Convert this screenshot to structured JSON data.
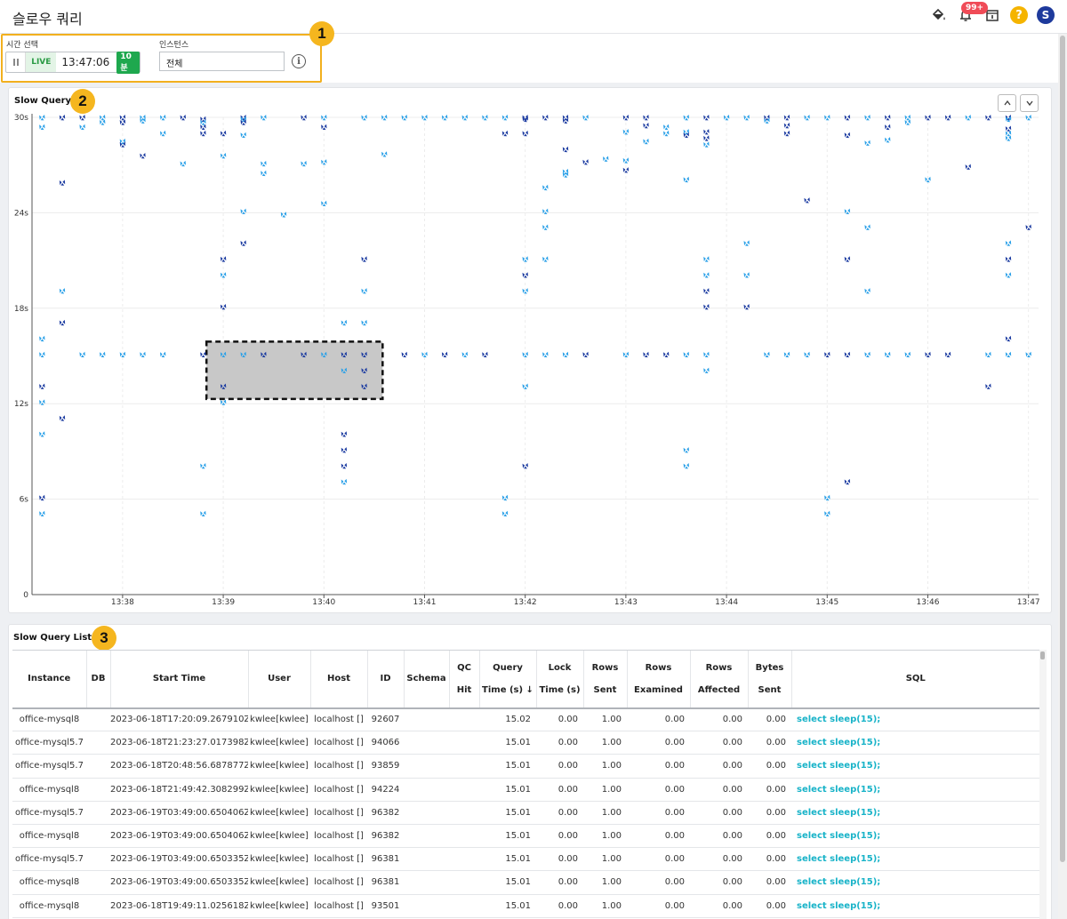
{
  "header": {
    "title": "슬로우 쿼리",
    "notification_count": "99+",
    "help_label": "?",
    "user_initial": "S"
  },
  "filters": {
    "time_label": "시간 선택",
    "live_label": "LIVE",
    "clock": "13:47:06",
    "range": "10분",
    "instance_label": "인스턴스",
    "instance_value": "전체"
  },
  "callouts": [
    "1",
    "2",
    "3"
  ],
  "chart": {
    "title": "Slow Query",
    "y_ticks": [
      "0",
      "6s",
      "12s",
      "18s",
      "24s",
      "30s"
    ],
    "x_ticks": [
      "13:38",
      "13:39",
      "13:40",
      "13:41",
      "13:42",
      "13:43",
      "13:44",
      "13:45",
      "13:46",
      "13:47"
    ]
  },
  "chart_data": {
    "type": "scatter",
    "title": "Slow Query",
    "y_unit": "s",
    "ylim": [
      0,
      30
    ],
    "x_range": [
      "13:37:06",
      "13:47:06"
    ],
    "colors": {
      "dark": "#1a3aa0",
      "light": "#2aa0e8"
    },
    "selection": {
      "x": [
        "13:38:50",
        "13:40:35"
      ],
      "y": [
        12.3,
        15.9
      ]
    },
    "points": [
      [
        "13:37:12",
        30,
        "l"
      ],
      [
        "13:37:12",
        29.4,
        "l"
      ],
      [
        "13:37:12",
        16.1,
        "l"
      ],
      [
        "13:37:12",
        15.1,
        "l"
      ],
      [
        "13:37:12",
        13.1,
        "d"
      ],
      [
        "13:37:12",
        12.1,
        "l"
      ],
      [
        "13:37:12",
        10.1,
        "l"
      ],
      [
        "13:37:12",
        6.1,
        "d"
      ],
      [
        "13:37:12",
        5.1,
        "l"
      ],
      [
        "13:37:24",
        30,
        "d"
      ],
      [
        "13:37:24",
        25.9,
        "d"
      ],
      [
        "13:37:24",
        19.1,
        "l"
      ],
      [
        "13:37:24",
        17.1,
        "d"
      ],
      [
        "13:37:24",
        11.1,
        "d"
      ],
      [
        "13:37:36",
        30,
        "d"
      ],
      [
        "13:37:36",
        29.4,
        "l"
      ],
      [
        "13:37:36",
        15.1,
        "l"
      ],
      [
        "13:37:48",
        30,
        "l"
      ],
      [
        "13:37:48",
        29.7,
        "l"
      ],
      [
        "13:37:48",
        15.1,
        "l"
      ],
      [
        "13:38:00",
        30,
        "d"
      ],
      [
        "13:38:00",
        29.7,
        "d"
      ],
      [
        "13:38:00",
        28.5,
        "l"
      ],
      [
        "13:38:00",
        28.3,
        "d"
      ],
      [
        "13:38:00",
        15.1,
        "l"
      ],
      [
        "13:38:12",
        30,
        "l"
      ],
      [
        "13:38:12",
        29.8,
        "l"
      ],
      [
        "13:38:12",
        27.6,
        "d"
      ],
      [
        "13:38:12",
        15.1,
        "l"
      ],
      [
        "13:38:24",
        30,
        "l"
      ],
      [
        "13:38:24",
        29,
        "l"
      ],
      [
        "13:38:24",
        15.1,
        "l"
      ],
      [
        "13:38:36",
        30,
        "d"
      ],
      [
        "13:38:36",
        27.1,
        "l"
      ],
      [
        "13:38:48",
        29.9,
        "d"
      ],
      [
        "13:38:48",
        29.7,
        "l"
      ],
      [
        "13:38:48",
        29.4,
        "d"
      ],
      [
        "13:38:48",
        29,
        "d"
      ],
      [
        "13:38:48",
        15.1,
        "d"
      ],
      [
        "13:38:48",
        8.1,
        "l"
      ],
      [
        "13:38:48",
        5.1,
        "l"
      ],
      [
        "13:39:00",
        29,
        "d"
      ],
      [
        "13:39:00",
        27.6,
        "l"
      ],
      [
        "13:39:00",
        21.1,
        "d"
      ],
      [
        "13:39:00",
        20.1,
        "l"
      ],
      [
        "13:39:00",
        18.1,
        "d"
      ],
      [
        "13:39:00",
        15.1,
        "l"
      ],
      [
        "13:39:00",
        13.1,
        "d"
      ],
      [
        "13:39:00",
        12.1,
        "l"
      ],
      [
        "13:39:12",
        30,
        "d"
      ],
      [
        "13:39:12",
        29.9,
        "l"
      ],
      [
        "13:39:12",
        29.7,
        "d"
      ],
      [
        "13:39:12",
        28.9,
        "l"
      ],
      [
        "13:39:12",
        24.1,
        "l"
      ],
      [
        "13:39:12",
        22.1,
        "d"
      ],
      [
        "13:39:12",
        15.1,
        "l"
      ],
      [
        "13:39:24",
        30,
        "l"
      ],
      [
        "13:39:24",
        27.1,
        "l"
      ],
      [
        "13:39:24",
        26.5,
        "l"
      ],
      [
        "13:39:24",
        15.1,
        "d"
      ],
      [
        "13:39:36",
        23.9,
        "l"
      ],
      [
        "13:39:48",
        30,
        "d"
      ],
      [
        "13:39:48",
        27.1,
        "l"
      ],
      [
        "13:39:48",
        15.1,
        "d"
      ],
      [
        "13:40:00",
        30,
        "l"
      ],
      [
        "13:40:00",
        29.4,
        "d"
      ],
      [
        "13:40:00",
        27.2,
        "l"
      ],
      [
        "13:40:00",
        24.6,
        "l"
      ],
      [
        "13:40:00",
        15.1,
        "l"
      ],
      [
        "13:40:12",
        17.1,
        "l"
      ],
      [
        "13:40:12",
        15.1,
        "d"
      ],
      [
        "13:40:12",
        14.1,
        "l"
      ],
      [
        "13:40:12",
        10.1,
        "d"
      ],
      [
        "13:40:12",
        9.1,
        "d"
      ],
      [
        "13:40:12",
        8.1,
        "d"
      ],
      [
        "13:40:12",
        7.1,
        "l"
      ],
      [
        "13:40:24",
        30,
        "l"
      ],
      [
        "13:40:24",
        21.1,
        "d"
      ],
      [
        "13:40:24",
        19.1,
        "l"
      ],
      [
        "13:40:24",
        17.1,
        "l"
      ],
      [
        "13:40:24",
        15.1,
        "d"
      ],
      [
        "13:40:24",
        14.1,
        "d"
      ],
      [
        "13:40:24",
        13.1,
        "d"
      ],
      [
        "13:40:36",
        30,
        "l"
      ],
      [
        "13:40:36",
        27.7,
        "l"
      ],
      [
        "13:40:48",
        30,
        "l"
      ],
      [
        "13:40:48",
        15.1,
        "d"
      ],
      [
        "13:41:00",
        30,
        "l"
      ],
      [
        "13:41:00",
        15.1,
        "l"
      ],
      [
        "13:41:12",
        30,
        "l"
      ],
      [
        "13:41:12",
        15.1,
        "d"
      ],
      [
        "13:41:24",
        30,
        "l"
      ],
      [
        "13:41:24",
        15.1,
        "l"
      ],
      [
        "13:41:36",
        30,
        "l"
      ],
      [
        "13:41:36",
        15.1,
        "d"
      ],
      [
        "13:41:48",
        30,
        "l"
      ],
      [
        "13:41:48",
        29,
        "d"
      ],
      [
        "13:41:48",
        6.1,
        "l"
      ],
      [
        "13:41:48",
        5.1,
        "l"
      ],
      [
        "13:42:00",
        30,
        "d"
      ],
      [
        "13:42:00",
        29.9,
        "d"
      ],
      [
        "13:42:00",
        29,
        "d"
      ],
      [
        "13:42:00",
        21.1,
        "l"
      ],
      [
        "13:42:00",
        20.1,
        "d"
      ],
      [
        "13:42:00",
        19.1,
        "l"
      ],
      [
        "13:42:00",
        15.1,
        "l"
      ],
      [
        "13:42:00",
        13.1,
        "l"
      ],
      [
        "13:42:00",
        8.1,
        "d"
      ],
      [
        "13:42:12",
        30,
        "d"
      ],
      [
        "13:42:12",
        25.6,
        "l"
      ],
      [
        "13:42:12",
        24.1,
        "l"
      ],
      [
        "13:42:12",
        23.1,
        "l"
      ],
      [
        "13:42:12",
        21.1,
        "l"
      ],
      [
        "13:42:12",
        15.1,
        "l"
      ],
      [
        "13:42:24",
        30,
        "d"
      ],
      [
        "13:42:24",
        29.8,
        "d"
      ],
      [
        "13:42:24",
        28,
        "d"
      ],
      [
        "13:42:24",
        26.6,
        "l"
      ],
      [
        "13:42:24",
        26.4,
        "l"
      ],
      [
        "13:42:24",
        15.1,
        "l"
      ],
      [
        "13:42:36",
        30,
        "l"
      ],
      [
        "13:42:36",
        27.2,
        "d"
      ],
      [
        "13:42:36",
        15.1,
        "d"
      ],
      [
        "13:42:48",
        27.4,
        "l"
      ],
      [
        "13:43:00",
        30,
        "d"
      ],
      [
        "13:43:00",
        29.1,
        "l"
      ],
      [
        "13:43:00",
        27.3,
        "l"
      ],
      [
        "13:43:00",
        26.7,
        "d"
      ],
      [
        "13:43:00",
        15.1,
        "l"
      ],
      [
        "13:43:12",
        30,
        "d"
      ],
      [
        "13:43:12",
        29.5,
        "d"
      ],
      [
        "13:43:12",
        28.5,
        "l"
      ],
      [
        "13:43:12",
        15.1,
        "d"
      ],
      [
        "13:43:24",
        29.4,
        "l"
      ],
      [
        "13:43:24",
        29,
        "l"
      ],
      [
        "13:43:24",
        15.1,
        "d"
      ],
      [
        "13:43:36",
        30,
        "l"
      ],
      [
        "13:43:36",
        29.1,
        "l"
      ],
      [
        "13:43:36",
        28.9,
        "d"
      ],
      [
        "13:43:36",
        26.1,
        "l"
      ],
      [
        "13:43:36",
        15.1,
        "l"
      ],
      [
        "13:43:36",
        9.1,
        "l"
      ],
      [
        "13:43:36",
        8.1,
        "l"
      ],
      [
        "13:43:48",
        30,
        "d"
      ],
      [
        "13:43:48",
        29.1,
        "d"
      ],
      [
        "13:43:48",
        28.7,
        "d"
      ],
      [
        "13:43:48",
        28.3,
        "l"
      ],
      [
        "13:43:48",
        21.1,
        "l"
      ],
      [
        "13:43:48",
        20.1,
        "l"
      ],
      [
        "13:43:48",
        19.1,
        "d"
      ],
      [
        "13:43:48",
        18.1,
        "d"
      ],
      [
        "13:43:48",
        15.1,
        "l"
      ],
      [
        "13:43:48",
        14.1,
        "l"
      ],
      [
        "13:44:00",
        30,
        "l"
      ],
      [
        "13:44:12",
        30,
        "l"
      ],
      [
        "13:44:12",
        22.1,
        "l"
      ],
      [
        "13:44:12",
        20.1,
        "l"
      ],
      [
        "13:44:12",
        18.1,
        "d"
      ],
      [
        "13:44:24",
        30,
        "d"
      ],
      [
        "13:44:24",
        29.8,
        "l"
      ],
      [
        "13:44:24",
        15.1,
        "l"
      ],
      [
        "13:44:36",
        30,
        "d"
      ],
      [
        "13:44:36",
        29.5,
        "d"
      ],
      [
        "13:44:36",
        29,
        "d"
      ],
      [
        "13:44:36",
        15.1,
        "l"
      ],
      [
        "13:44:48",
        30,
        "l"
      ],
      [
        "13:44:48",
        24.8,
        "d"
      ],
      [
        "13:44:48",
        15.1,
        "l"
      ],
      [
        "13:45:00",
        30,
        "l"
      ],
      [
        "13:45:00",
        15.1,
        "d"
      ],
      [
        "13:45:00",
        6.1,
        "l"
      ],
      [
        "13:45:00",
        5.1,
        "l"
      ],
      [
        "13:45:12",
        30,
        "d"
      ],
      [
        "13:45:12",
        28.9,
        "d"
      ],
      [
        "13:45:12",
        24.1,
        "l"
      ],
      [
        "13:45:12",
        21.1,
        "d"
      ],
      [
        "13:45:12",
        15.1,
        "d"
      ],
      [
        "13:45:12",
        7.1,
        "d"
      ],
      [
        "13:45:24",
        30,
        "l"
      ],
      [
        "13:45:24",
        28.4,
        "l"
      ],
      [
        "13:45:24",
        23.1,
        "l"
      ],
      [
        "13:45:24",
        19.1,
        "l"
      ],
      [
        "13:45:24",
        15.1,
        "l"
      ],
      [
        "13:45:36",
        30,
        "d"
      ],
      [
        "13:45:36",
        29.4,
        "d"
      ],
      [
        "13:45:36",
        28.6,
        "l"
      ],
      [
        "13:45:36",
        15.1,
        "l"
      ],
      [
        "13:45:48",
        30,
        "l"
      ],
      [
        "13:45:48",
        29.7,
        "l"
      ],
      [
        "13:45:48",
        15.1,
        "l"
      ],
      [
        "13:46:00",
        30,
        "d"
      ],
      [
        "13:46:00",
        26.1,
        "l"
      ],
      [
        "13:46:00",
        15.1,
        "d"
      ],
      [
        "13:46:12",
        30,
        "d"
      ],
      [
        "13:46:12",
        15.1,
        "d"
      ],
      [
        "13:46:24",
        30,
        "l"
      ],
      [
        "13:46:24",
        26.9,
        "d"
      ],
      [
        "13:46:36",
        30,
        "d"
      ],
      [
        "13:46:36",
        15.1,
        "l"
      ],
      [
        "13:46:36",
        13.1,
        "d"
      ],
      [
        "13:46:48",
        30,
        "d"
      ],
      [
        "13:46:48",
        29.9,
        "l"
      ],
      [
        "13:46:48",
        29.3,
        "d"
      ],
      [
        "13:46:48",
        29,
        "l"
      ],
      [
        "13:46:48",
        28.7,
        "l"
      ],
      [
        "13:46:48",
        22.1,
        "l"
      ],
      [
        "13:46:48",
        21.1,
        "d"
      ],
      [
        "13:46:48",
        20.1,
        "l"
      ],
      [
        "13:46:48",
        16.1,
        "d"
      ],
      [
        "13:46:48",
        15.1,
        "l"
      ],
      [
        "13:47:00",
        30,
        "l"
      ],
      [
        "13:47:00",
        23.1,
        "d"
      ],
      [
        "13:47:00",
        15.1,
        "l"
      ]
    ]
  },
  "list": {
    "title": "Slow Query List",
    "columns": [
      {
        "key": "instance",
        "label": "Instance",
        "w": 83
      },
      {
        "key": "db",
        "label": "DB",
        "w": 27
      },
      {
        "key": "start",
        "label": "Start Time",
        "w": 155
      },
      {
        "key": "user",
        "label": "User",
        "w": 70
      },
      {
        "key": "host",
        "label": "Host",
        "w": 64
      },
      {
        "key": "id",
        "label": "ID",
        "w": 41
      },
      {
        "key": "schema",
        "label": "Schema",
        "w": 51
      },
      {
        "key": "qc",
        "label": "QC Hit",
        "w": 34
      },
      {
        "key": "qtime",
        "label": "Query Time (s) ↓",
        "w": 64
      },
      {
        "key": "ltime",
        "label": "Lock Time (s)",
        "w": 53
      },
      {
        "key": "sent",
        "label": "Rows Sent",
        "w": 49
      },
      {
        "key": "examined",
        "label": "Rows Examined",
        "w": 71
      },
      {
        "key": "affected",
        "label": "Rows Affected",
        "w": 65
      },
      {
        "key": "bytes",
        "label": "Bytes Sent",
        "w": 49
      },
      {
        "key": "sql",
        "label": "SQL",
        "w": 279
      }
    ],
    "rows": [
      {
        "instance": "office-mysql8",
        "db": "",
        "start": "2023-06-18T17:20:09.267910Z",
        "user": "kwlee[kwlee]",
        "host": "localhost []",
        "id": "92607",
        "schema": "",
        "qc": "",
        "qtime": "15.02",
        "ltime": "0.00",
        "sent": "1.00",
        "examined": "0.00",
        "affected": "0.00",
        "bytes": "0.00",
        "sql": "select sleep(15);"
      },
      {
        "instance": "office-mysql5.7",
        "db": "",
        "start": "2023-06-18T21:23:27.017398Z",
        "user": "kwlee[kwlee]",
        "host": "localhost []",
        "id": "94066",
        "schema": "",
        "qc": "",
        "qtime": "15.01",
        "ltime": "0.00",
        "sent": "1.00",
        "examined": "0.00",
        "affected": "0.00",
        "bytes": "0.00",
        "sql": "select sleep(15);"
      },
      {
        "instance": "office-mysql5.7",
        "db": "",
        "start": "2023-06-18T20:48:56.687877Z",
        "user": "kwlee[kwlee]",
        "host": "localhost []",
        "id": "93859",
        "schema": "",
        "qc": "",
        "qtime": "15.01",
        "ltime": "0.00",
        "sent": "1.00",
        "examined": "0.00",
        "affected": "0.00",
        "bytes": "0.00",
        "sql": "select sleep(15);"
      },
      {
        "instance": "office-mysql8",
        "db": "",
        "start": "2023-06-18T21:49:42.308299Z",
        "user": "kwlee[kwlee]",
        "host": "localhost []",
        "id": "94224",
        "schema": "",
        "qc": "",
        "qtime": "15.01",
        "ltime": "0.00",
        "sent": "1.00",
        "examined": "0.00",
        "affected": "0.00",
        "bytes": "0.00",
        "sql": "select sleep(15);"
      },
      {
        "instance": "office-mysql5.7",
        "db": "",
        "start": "2023-06-19T03:49:00.650406Z",
        "user": "kwlee[kwlee]",
        "host": "localhost []",
        "id": "96382",
        "schema": "",
        "qc": "",
        "qtime": "15.01",
        "ltime": "0.00",
        "sent": "1.00",
        "examined": "0.00",
        "affected": "0.00",
        "bytes": "0.00",
        "sql": "select sleep(15);"
      },
      {
        "instance": "office-mysql8",
        "db": "",
        "start": "2023-06-19T03:49:00.650406Z",
        "user": "kwlee[kwlee]",
        "host": "localhost []",
        "id": "96382",
        "schema": "",
        "qc": "",
        "qtime": "15.01",
        "ltime": "0.00",
        "sent": "1.00",
        "examined": "0.00",
        "affected": "0.00",
        "bytes": "0.00",
        "sql": "select sleep(15);"
      },
      {
        "instance": "office-mysql5.7",
        "db": "",
        "start": "2023-06-19T03:49:00.650335Z",
        "user": "kwlee[kwlee]",
        "host": "localhost []",
        "id": "96381",
        "schema": "",
        "qc": "",
        "qtime": "15.01",
        "ltime": "0.00",
        "sent": "1.00",
        "examined": "0.00",
        "affected": "0.00",
        "bytes": "0.00",
        "sql": "select sleep(15);"
      },
      {
        "instance": "office-mysql8",
        "db": "",
        "start": "2023-06-19T03:49:00.650335Z",
        "user": "kwlee[kwlee]",
        "host": "localhost []",
        "id": "96381",
        "schema": "",
        "qc": "",
        "qtime": "15.01",
        "ltime": "0.00",
        "sent": "1.00",
        "examined": "0.00",
        "affected": "0.00",
        "bytes": "0.00",
        "sql": "select sleep(15);"
      },
      {
        "instance": "office-mysql8",
        "db": "",
        "start": "2023-06-18T19:49:11.025618Z",
        "user": "kwlee[kwlee]",
        "host": "localhost []",
        "id": "93501",
        "schema": "",
        "qc": "",
        "qtime": "15.01",
        "ltime": "0.00",
        "sent": "1.00",
        "examined": "0.00",
        "affected": "0.00",
        "bytes": "0.00",
        "sql": "select sleep(15);"
      }
    ]
  }
}
